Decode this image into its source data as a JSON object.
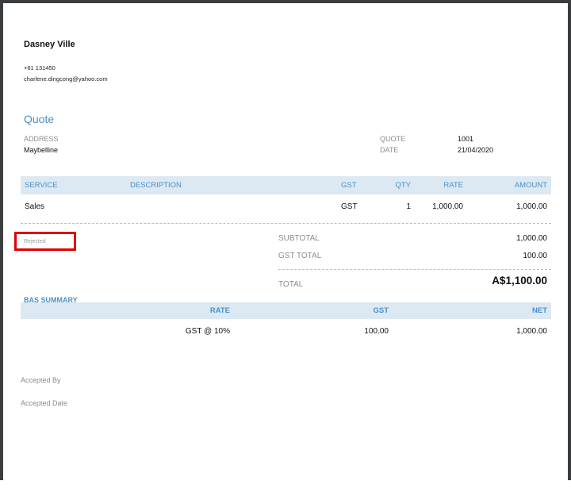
{
  "company": {
    "name": "Dasney Ville",
    "phone": "+61 131450",
    "email": "charlene.dingcong@yahoo.com"
  },
  "document": {
    "title": "Quote",
    "address_label": "ADDRESS",
    "address_value": "Maybelline",
    "quote_label": "QUOTE",
    "quote_value": "1001",
    "date_label": "DATE",
    "date_value": "21/04/2020"
  },
  "items_table": {
    "headers": {
      "service": "SERVICE",
      "description": "DESCRIPTION",
      "gst": "GST",
      "qty": "QTY",
      "rate": "RATE",
      "amount": "AMOUNT"
    },
    "rows": [
      {
        "service": "Sales",
        "description": "",
        "gst": "GST",
        "qty": "1",
        "rate": "1,000.00",
        "amount": "1,000.00"
      }
    ]
  },
  "status": {
    "label": "Rejected",
    "highlight_color": "#e00000"
  },
  "totals": {
    "subtotal_label": "SUBTOTAL",
    "subtotal_value": "1,000.00",
    "gst_total_label": "GST TOTAL",
    "gst_total_value": "100.00",
    "total_label": "TOTAL",
    "total_value": "A$1,100.00"
  },
  "bas_summary": {
    "title": "BAS SUMMARY",
    "headers": {
      "rate": "RATE",
      "gst": "GST",
      "net": "NET"
    },
    "rows": [
      {
        "rate": "GST @ 10%",
        "gst": "100.00",
        "net": "1,000.00"
      }
    ]
  },
  "footer": {
    "accepted_by_label": "Accepted By",
    "accepted_date_label": "Accepted Date"
  },
  "colors": {
    "accent": "#4a90c8",
    "header_band": "#dce8f2",
    "frame": "#3a3d40"
  }
}
